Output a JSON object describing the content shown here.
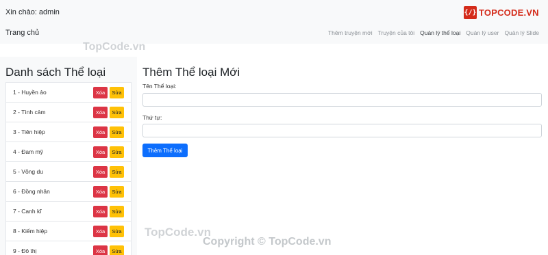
{
  "header": {
    "greeting": "Xin chào: admin",
    "home_link": "Trang chủ",
    "logo_badge": "{/}",
    "logo_text": "TOPCODE.VN",
    "nav": [
      "Thêm truyện mới",
      "Truyện của tôi",
      "Quản lý thể loại",
      "Quản lý user",
      "Quản lý Slide"
    ],
    "active_nav": "Quản lý thể loại"
  },
  "sidebar": {
    "title": "Danh sách Thể loại",
    "delete_label": "Xóa",
    "edit_label": "Sửa",
    "items": [
      "1 - Huyền ảo",
      "2 - Tình cảm",
      "3 - Tiên hiệp",
      "4 - Đam mỹ",
      "5 - Võng du",
      "6 - Đồng nhân",
      "7 - Canh kĩ",
      "8 - Kiếm hiệp",
      "9 - Đô thị"
    ]
  },
  "form": {
    "title": "Thêm Thể loại Mới",
    "name_label": "Tên Thể loại:",
    "name_value": "",
    "order_label": "Thứ tự:",
    "order_value": "",
    "submit_label": "Thêm Thể loại"
  },
  "watermarks": {
    "top": "TopCode.vn",
    "bottom": "TopCode.vn",
    "copyright": "Copyright © TopCode.vn"
  },
  "colors": {
    "navbar_bg": "#f8f9fa",
    "delete": "#dc3545",
    "edit": "#ffc107",
    "primary": "#0d6efd",
    "logo": "#d42b1a"
  }
}
